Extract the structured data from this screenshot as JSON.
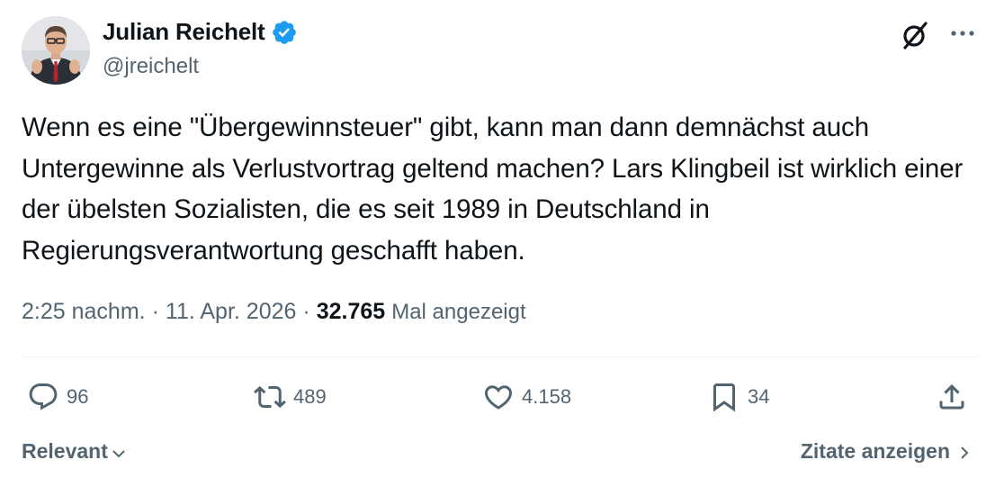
{
  "author": {
    "display_name": "Julian Reichelt",
    "handle": "@jreichelt",
    "verified": true,
    "verified_color": "#1d9bf0"
  },
  "header_icons": {
    "grok": "grok-slash-icon",
    "more": "more-horizontal-icon"
  },
  "tweet": {
    "text": "Wenn es eine \"Übergewinnsteuer\" gibt, kann man dann demnächst auch Untergewinne als Verlustvortrag geltend machen? Lars Klingbeil ist wirklich einer der übelsten Sozialisten, die es seit 1989 in Deutschland in Regierungsverantwortung geschafft haben."
  },
  "meta": {
    "time": "2:25 nachm.",
    "separator": "·",
    "date": "11. Apr. 2026",
    "views_count": "32.765",
    "views_label": "Mal angezeigt"
  },
  "actions": {
    "replies": "96",
    "reposts": "489",
    "likes": "4.158",
    "bookmarks": "34"
  },
  "footer": {
    "sort_label": "Relevant",
    "quotes_label": "Zitate anzeigen"
  },
  "colors": {
    "text_primary": "#0f1419",
    "text_secondary": "#536471",
    "divider": "#eff3f4",
    "accent": "#1d9bf0"
  }
}
